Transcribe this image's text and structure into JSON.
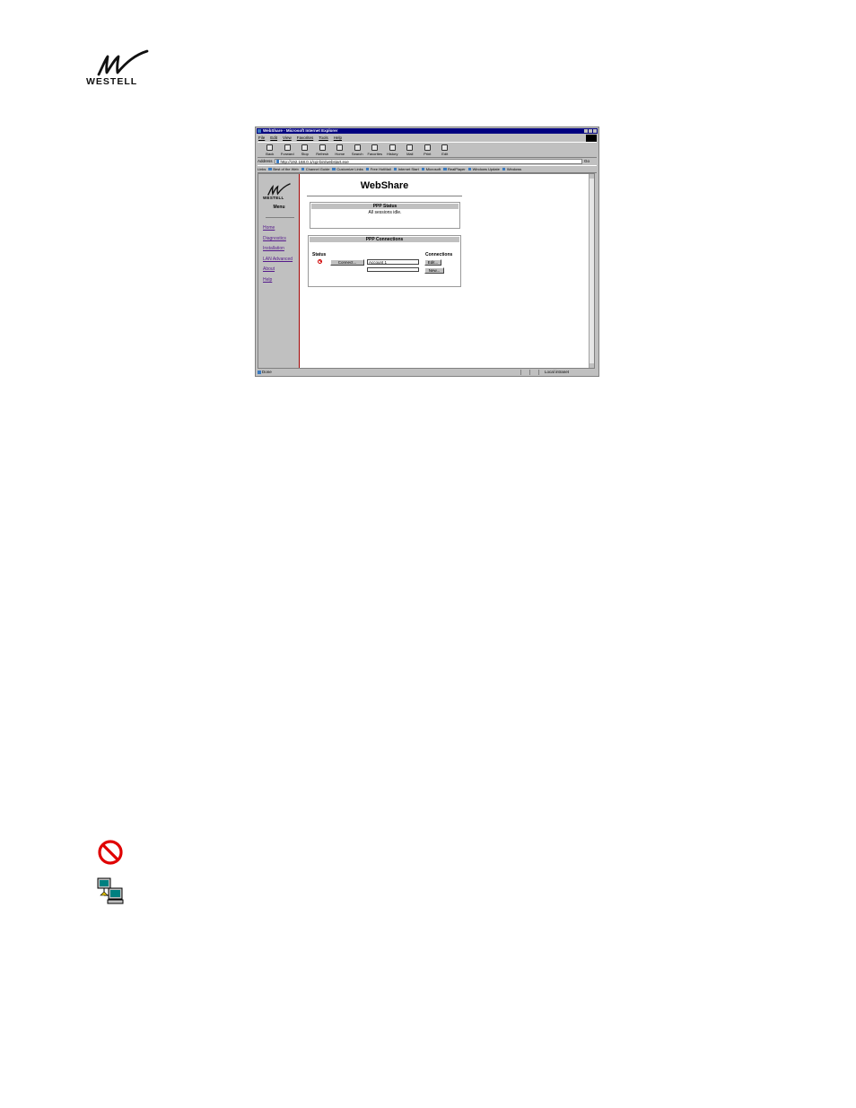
{
  "logo": {
    "brand": "WESTELL"
  },
  "browser": {
    "title": "WebShare - Microsoft Internet Explorer",
    "menu": [
      "File",
      "Edit",
      "View",
      "Favorites",
      "Tools",
      "Help"
    ],
    "toolbar": [
      "Back",
      "Forward",
      "Stop",
      "Refresh",
      "Home",
      "Search",
      "Favorites",
      "History",
      "Mail",
      "Print",
      "Edit"
    ],
    "address_label": "Address",
    "address_value": "http://192.168.0.1/cgi-bin/webstart.exe",
    "go_label": "Go",
    "links_label": "Links",
    "links": [
      "Best of the Web",
      "Channel Guide",
      "Customize Links",
      "Free HotMail",
      "Internet Start",
      "Microsoft",
      "RealPlayer",
      "Windows Update",
      "Windows"
    ],
    "status_left": "Done",
    "status_zone": "Local intranet"
  },
  "webpage": {
    "nav_brand": "WESTELL",
    "menu_title": "Menu",
    "nav_items": [
      "Home",
      "Diagnostics",
      "Installation",
      "LAN Advanced",
      "About",
      "Help"
    ],
    "page_title": "WebShare",
    "ppp_status_header": "PPP Status",
    "ppp_status_message": "All sessions idle.",
    "ppp_connections_header": "PPP Connections",
    "status_col": "Status",
    "connections_col": "Connections",
    "connect_button": "Connect...",
    "account_value": "Account 1",
    "edit_button": "Edit...",
    "new_button": "New..."
  },
  "legend_icons": [
    "stop-icon",
    "connected-computers-icon"
  ],
  "colors": {
    "title_bar": "#000080",
    "nav_divider": "#a00000",
    "stop_red": "#d00000"
  }
}
